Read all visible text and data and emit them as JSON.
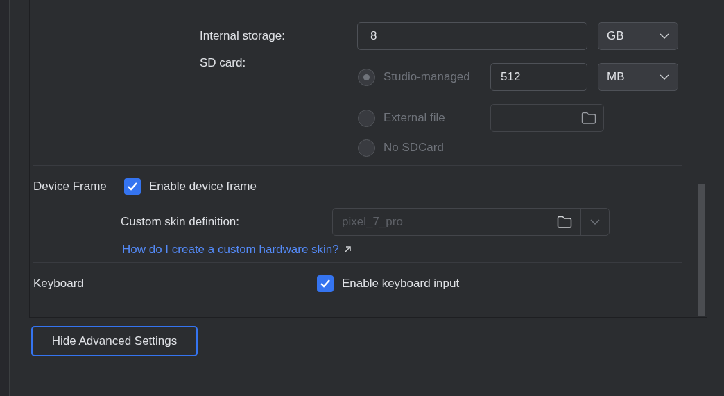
{
  "internal_storage": {
    "label": "Internal storage:",
    "value": "8",
    "unit": "GB"
  },
  "sd_card": {
    "label": "SD card:",
    "disabled": true,
    "options": [
      {
        "kind": "size",
        "label": "Studio-managed",
        "selected": true,
        "value": "512",
        "unit": "MB"
      },
      {
        "kind": "file",
        "label": "External file",
        "selected": false
      },
      {
        "kind": "none",
        "label": "No SDCard",
        "selected": false
      }
    ]
  },
  "device_frame": {
    "label": "Device Frame",
    "checkbox": {
      "label": "Enable device frame",
      "checked": true
    },
    "skin": {
      "label": "Custom skin definition:",
      "value": "pixel_7_pro",
      "disabled": true
    },
    "link": "How do I create a custom hardware skin?"
  },
  "keyboard": {
    "label": "Keyboard",
    "checkbox": {
      "label": "Enable keyboard input",
      "checked": true
    }
  },
  "button": {
    "label": "Hide Advanced Settings",
    "focused": true
  }
}
